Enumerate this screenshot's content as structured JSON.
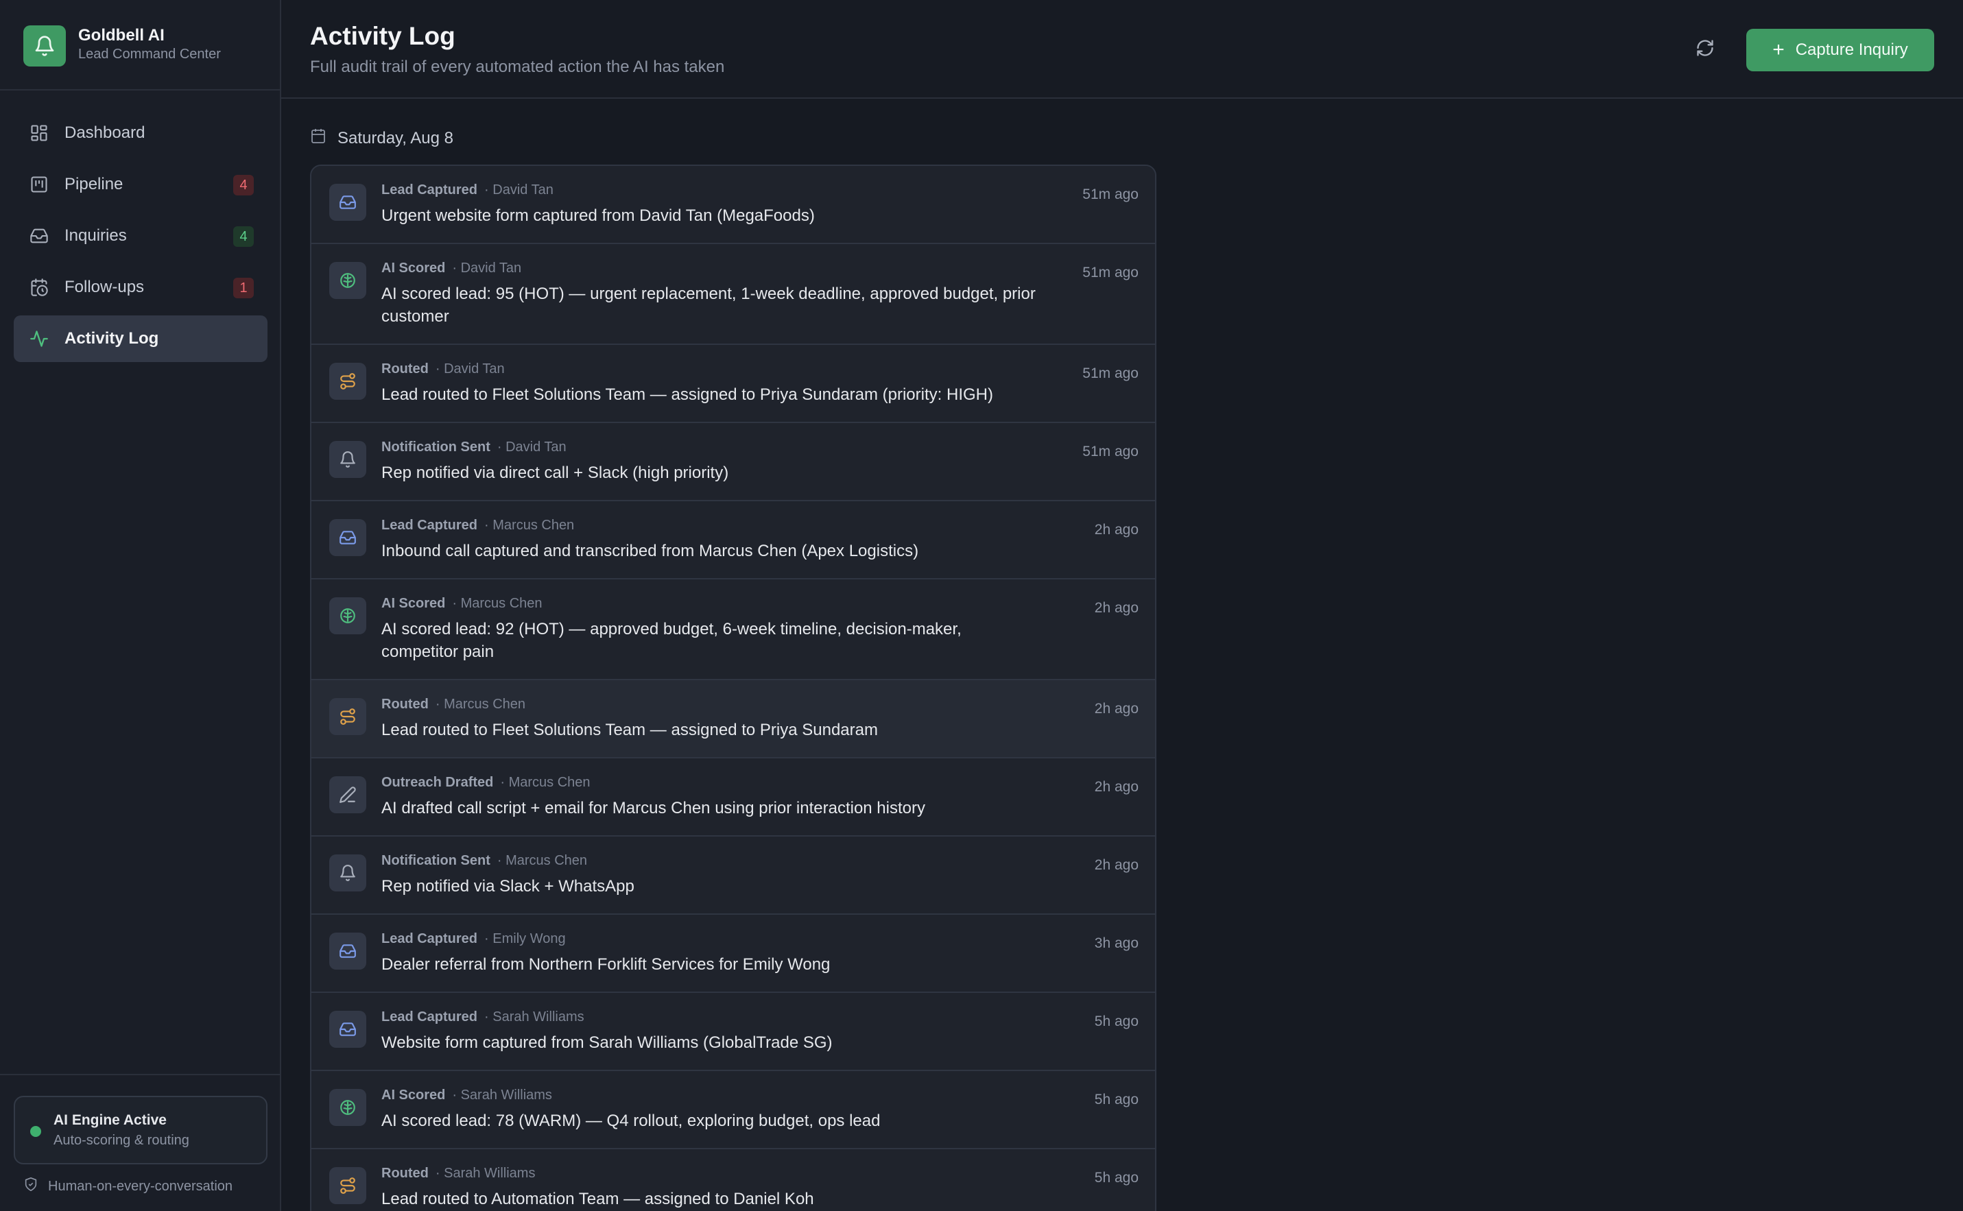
{
  "app": {
    "name": "Goldbell AI",
    "subtitle": "Lead Command Center"
  },
  "nav": {
    "items": [
      {
        "label": "Dashboard",
        "icon": "dashboard-icon"
      },
      {
        "label": "Pipeline",
        "icon": "pipeline-icon",
        "badge": "4"
      },
      {
        "label": "Inquiries",
        "icon": "inbox-icon",
        "badge": "4"
      },
      {
        "label": "Follow-ups",
        "icon": "calendar-clock-icon",
        "badge": "1"
      },
      {
        "label": "Activity Log",
        "icon": "activity-icon",
        "active": true
      }
    ]
  },
  "engine": {
    "title": "AI Engine Active",
    "subtitle": "Auto-scoring & routing"
  },
  "footer_note": "Human-on-every-conversation",
  "header": {
    "title": "Activity Log",
    "subtitle": "Full audit trail of every automated action the AI has taken",
    "capture_label": "Capture Inquiry"
  },
  "date": "Saturday, Aug 8",
  "colors": {
    "accent": "#3f9a63",
    "lead_icon": "#7b9ae8",
    "scored_icon": "#4fbf7f",
    "routed_icon": "#e0a24a",
    "neutral_icon": "#aab0bc"
  },
  "entries": [
    {
      "type": "Lead Captured",
      "person": "· David Tan",
      "text": "Urgent website form captured from David Tan (MegaFoods)",
      "time": "51m ago",
      "icon": "inbox-icon"
    },
    {
      "type": "AI Scored",
      "person": "· David Tan",
      "text": "AI scored lead: 95 (HOT) — urgent replacement, 1-week deadline, approved budget, prior customer",
      "time": "51m ago",
      "icon": "brain-icon"
    },
    {
      "type": "Routed",
      "person": "· David Tan",
      "text": "Lead routed to Fleet Solutions Team — assigned to Priya Sundaram (priority: HIGH)",
      "time": "51m ago",
      "icon": "route-icon"
    },
    {
      "type": "Notification Sent",
      "person": "· David Tan",
      "text": "Rep notified via direct call + Slack (high priority)",
      "time": "51m ago",
      "icon": "bell-icon"
    },
    {
      "type": "Lead Captured",
      "person": "· Marcus Chen",
      "text": "Inbound call captured and transcribed from Marcus Chen (Apex Logistics)",
      "time": "2h ago",
      "icon": "inbox-icon"
    },
    {
      "type": "AI Scored",
      "person": "· Marcus Chen",
      "text": "AI scored lead: 92 (HOT) — approved budget, 6-week timeline, decision-maker, competitor pain",
      "time": "2h ago",
      "icon": "brain-icon"
    },
    {
      "type": "Routed",
      "person": "· Marcus Chen",
      "text": "Lead routed to Fleet Solutions Team — assigned to Priya Sundaram",
      "time": "2h ago",
      "icon": "route-icon"
    },
    {
      "type": "Outreach Drafted",
      "person": "· Marcus Chen",
      "text": "AI drafted call script + email for Marcus Chen using prior interaction history",
      "time": "2h ago",
      "icon": "pencil-icon"
    },
    {
      "type": "Notification Sent",
      "person": "· Marcus Chen",
      "text": "Rep notified via Slack + WhatsApp",
      "time": "2h ago",
      "icon": "bell-icon"
    },
    {
      "type": "Lead Captured",
      "person": "· Emily Wong",
      "text": "Dealer referral from Northern Forklift Services for Emily Wong",
      "time": "3h ago",
      "icon": "inbox-icon"
    },
    {
      "type": "Lead Captured",
      "person": "· Sarah Williams",
      "text": "Website form captured from Sarah Williams (GlobalTrade SG)",
      "time": "5h ago",
      "icon": "inbox-icon"
    },
    {
      "type": "AI Scored",
      "person": "· Sarah Williams",
      "text": "AI scored lead: 78 (WARM) — Q4 rollout, exploring budget, ops lead",
      "time": "5h ago",
      "icon": "brain-icon"
    },
    {
      "type": "Routed",
      "person": "· Sarah Williams",
      "text": "Lead routed to Automation Team — assigned to Daniel Koh",
      "time": "5h ago",
      "icon": "route-icon"
    }
  ]
}
